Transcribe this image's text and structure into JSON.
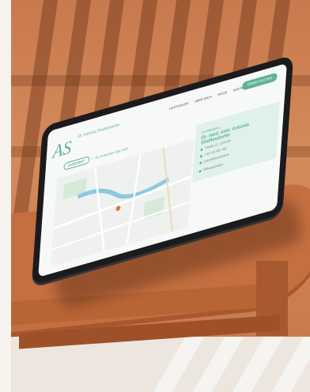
{
  "screen": {
    "logo": "AS",
    "brand_title": "Dr. Antonia Sindlesdorfer",
    "brand_sub": "",
    "nav": [
      "LEISTUNGEN",
      "ÜBER MICH",
      "INFOS",
      "KONTAKT"
    ],
    "cta": "TERMIN BUCHEN",
    "breadcrumb": {
      "pill": "KONTAKT",
      "separator": "•",
      "text": "So erreichen Sie mich"
    },
    "card": {
      "eyebrow": "Kontaktdaten",
      "name": "Dr. med. univ. Antonia Sindlesdorfer",
      "lines": [
        "Straße 12, 1234 Ort",
        "+43 123 456 789",
        "praxis@example.at",
        "Öffnungszeiten"
      ]
    }
  },
  "colors": {
    "accent": "#5fb29a",
    "wall": "#d48a5b",
    "table": "#c46f40",
    "tablet_frame": "#1b1b1d"
  }
}
